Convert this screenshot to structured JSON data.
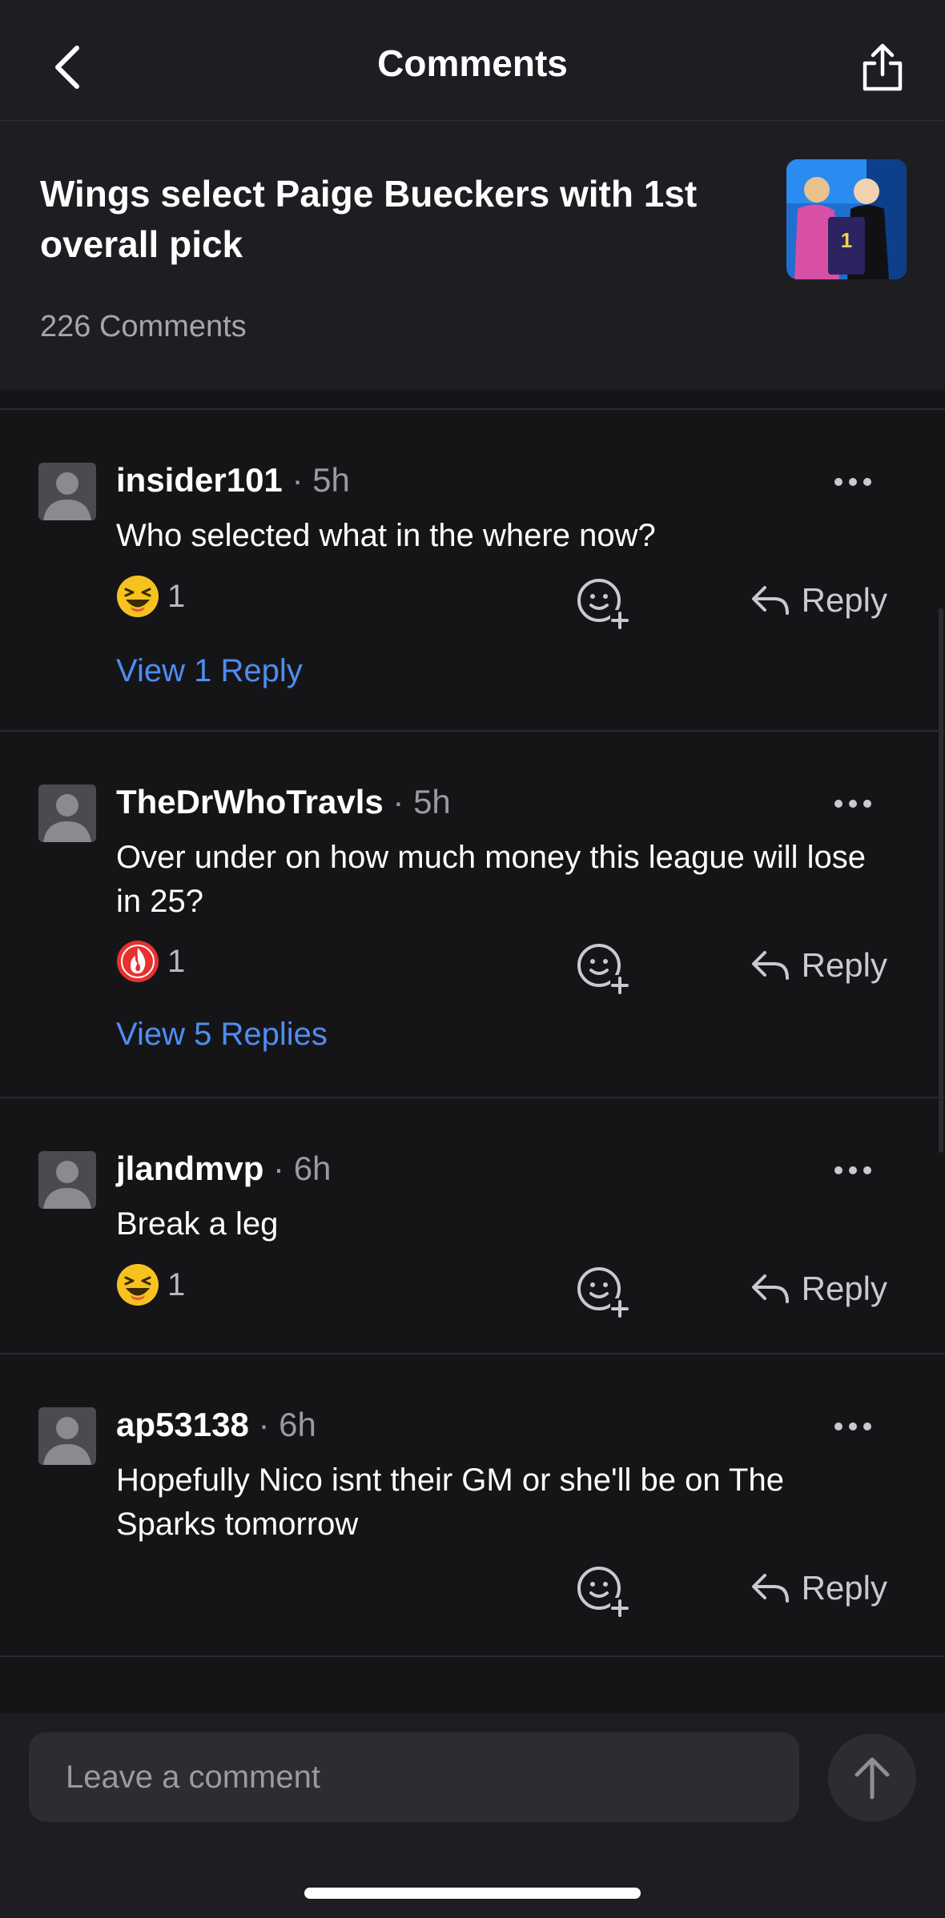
{
  "header": {
    "title": "Comments",
    "back_icon": "chevron-left-icon",
    "share_icon": "share-icon"
  },
  "article": {
    "title": "Wings select Paige Bueckers with 1st overall pick",
    "comment_count": "226 Comments"
  },
  "comments": [
    {
      "username": "insider101",
      "time": "5h",
      "text": "Who selected what in the where now?",
      "reaction_icon": "laughing-emoji-icon",
      "reaction_count": "1",
      "reply_label": "Reply",
      "view_replies": "View 1 Reply"
    },
    {
      "username": "TheDrWhoTravls",
      "time": "5h",
      "text": "Over under on how much money this league will lose in 25?",
      "reaction_icon": "fire-emoji-icon",
      "reaction_count": "1",
      "reply_label": "Reply",
      "view_replies": "View 5 Replies"
    },
    {
      "username": "jlandmvp",
      "time": "6h",
      "text": "Break a leg",
      "reaction_icon": "laughing-emoji-icon",
      "reaction_count": "1",
      "reply_label": "Reply"
    },
    {
      "username": "ap53138",
      "time": "6h",
      "text": "Hopefully Nico isnt their GM or she'll be on The Sparks tomorrow",
      "reply_label": "Reply"
    }
  ],
  "composer": {
    "placeholder": "Leave a comment",
    "send_icon": "arrow-up-icon"
  },
  "colors": {
    "background": "#151518",
    "panel": "#1e1e22",
    "link": "#4f8df0",
    "muted": "#9a9aa0"
  }
}
